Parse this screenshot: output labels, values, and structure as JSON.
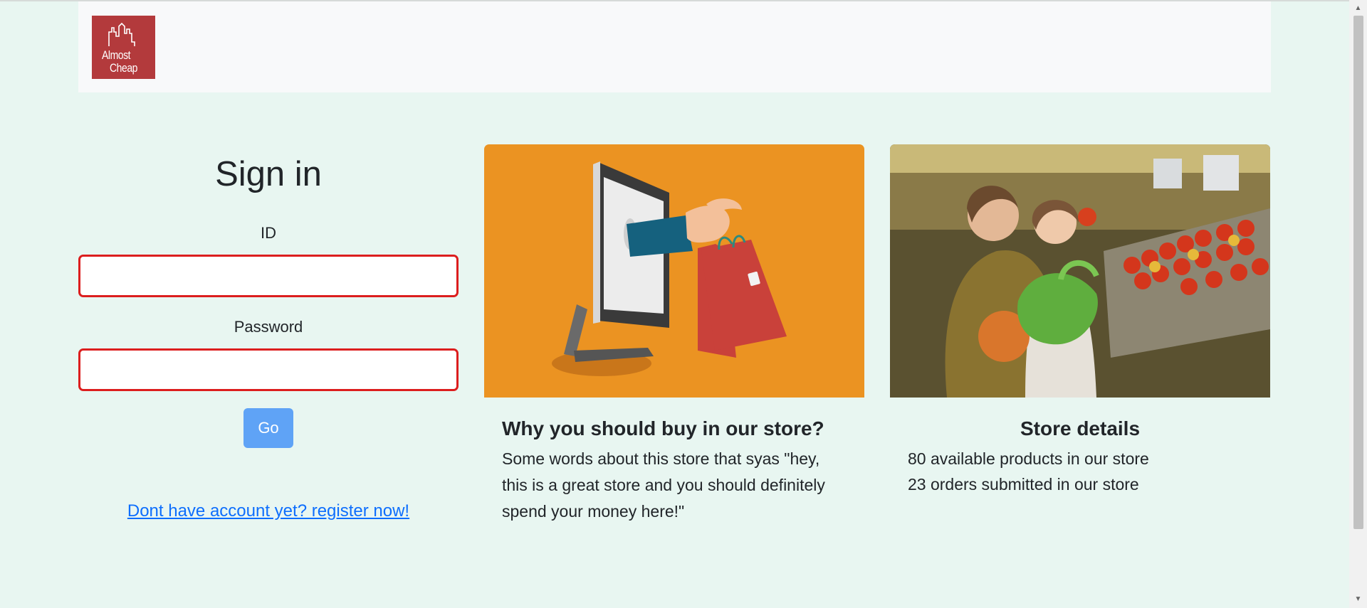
{
  "brand": {
    "line1": "Almost",
    "line2": "Cheap",
    "color": "#b33a3c"
  },
  "signin": {
    "title": "Sign in",
    "id_label": "ID",
    "id_value": "",
    "password_label": "Password",
    "password_value": "",
    "go_label": "Go",
    "register_link": "Dont have account yet? register now!"
  },
  "card_why": {
    "title": "Why you should buy in our store?",
    "text": "Some words about this store that syas \"hey, this is a great store and you should definitely spend your money here!\""
  },
  "card_details": {
    "title": "Store details",
    "stats": [
      "80 available products in our store",
      "23 orders submitted in our store"
    ]
  },
  "colors": {
    "background": "#e8f6f1",
    "error_border": "#dc1e1e",
    "button": "#5fa3f6",
    "link": "#0d6efd",
    "illustration_bg": "#eb9322"
  }
}
